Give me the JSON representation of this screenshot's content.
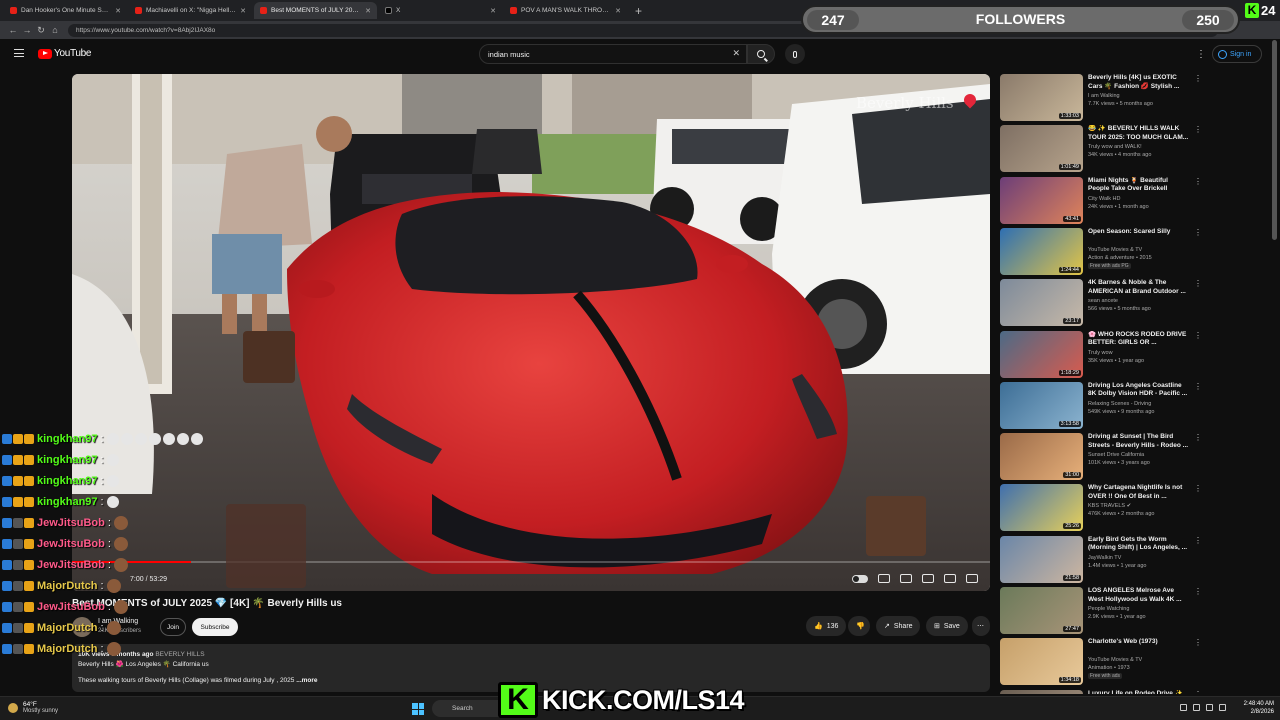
{
  "browser": {
    "tabs": [
      {
        "label": "Dan Hooker's One Minute Scrapi"
      },
      {
        "label": "Machiavelli on X: \"Nigga Hell Hit"
      },
      {
        "label": "Best MOMENTS of JULY 2025 🇺",
        "active": true
      },
      {
        "label": "X"
      },
      {
        "label": "POV A MAN'S WALK THROUG"
      }
    ],
    "url": "https://www.youtube.com/watch?v=8Abj2IJAX8o"
  },
  "youtube": {
    "logo": "YouTube",
    "search_value": "indian music",
    "sign_in": "Sign in"
  },
  "overlay": {
    "followers_current": "247",
    "followers_label": "FOLLOWERS",
    "followers_goal": "250",
    "viewer_count": "24",
    "kick_letter": "K",
    "kick_url": "KICK.COM/LS14"
  },
  "player": {
    "watermark": "Beverly Hills",
    "timecode": "7:00 / 53:29",
    "progress": 0.13
  },
  "video": {
    "title": "Best MOMENTS of JULY 2025 💎 [4K] 🌴 Beverly Hills us",
    "channel": "I am Walking",
    "subscribers": "21K subscribers",
    "join": "Join",
    "subscribe": "Subscribe",
    "likes": "136",
    "share": "Share",
    "save": "Save",
    "desc_meta": "10K views  6 months ago",
    "desc_hashtag": "BEVERLY HILLS",
    "desc_line2": "Beverly Hills 🌺 Los Angeles 🌴 California us",
    "desc_text": "These walking tours of Beverly Hills (Collage) was filmed during July , 2025 ",
    "desc_more": "...more"
  },
  "recommendations": [
    {
      "title": "Beverly Hills [4K] us EXOTIC Cars 🌴 Fashion 💋 Stylish ...",
      "channel": "I am Walking",
      "views": "7.7K views • 5 months ago",
      "duration": "1:33:03",
      "badge": "",
      "c1": "#8a7a6a",
      "c2": "#c9b79a"
    },
    {
      "title": "😂 ✨ BEVERLY HILLS WALK TOUR 2025: TOO MUCH GLAM...",
      "channel": "Truly wow and WALK!",
      "views": "34K views • 4 months ago",
      "duration": "1:01:49",
      "badge": "",
      "c1": "#7e6f63",
      "c2": "#b7a48c"
    },
    {
      "title": "Miami Nights 🍹 Beautiful People Take Over Brickell",
      "channel": "City Walk HD",
      "views": "24K views • 1 month ago",
      "duration": "43:41",
      "badge": "",
      "c1": "#6c3e78",
      "c2": "#e0845a"
    },
    {
      "title": "Open Season: Scared Silly",
      "channel": "YouTube Movies & TV",
      "views": "Action & adventure • 2015",
      "duration": "1:24:44",
      "badge": "Free with ads  PG",
      "c1": "#2e6fb3",
      "c2": "#e3c546"
    },
    {
      "title": "4K Barnes & Noble & The AMERICAN at Brand Outdoor ...",
      "channel": "sean ancete",
      "views": "566 views • 5 months ago",
      "duration": "23:17",
      "badge": "",
      "c1": "#7d8a9a",
      "c2": "#c7b9a8"
    },
    {
      "title": "🌸 WHO ROCKS RODEO DRIVE BETTER: GIRLS OR ...",
      "channel": "Truly wow",
      "views": "35K views • 1 year ago",
      "duration": "1:18:29",
      "badge": "",
      "c1": "#4c6a86",
      "c2": "#d85b4e"
    },
    {
      "title": "Driving Los Angeles Coastline 8K Dolby Vision HDR - Pacific ...",
      "channel": "Relaxing Scenes - Driving",
      "views": "549K views • 9 months ago",
      "duration": "3:13:58",
      "badge": "",
      "c1": "#3d6e96",
      "c2": "#8bb3cf"
    },
    {
      "title": "Driving at Sunset | The Bird Streets - Beverly Hills - Rodeo ...",
      "channel": "Sunset Drive California",
      "views": "101K views • 3 years ago",
      "duration": "31:00",
      "badge": "",
      "c1": "#9a6a48",
      "c2": "#e7b07a"
    },
    {
      "title": "Why Cartagena Nightlife Is not OVER !! One Of Best in ...",
      "channel": "KBS TRAVELS ✔",
      "views": "476K views • 2 months ago",
      "duration": "25:26",
      "badge": "",
      "c1": "#3f6fae",
      "c2": "#e7d05a"
    },
    {
      "title": "Early Bird Gets the Worm (Morning Shift) | Los Angeles, ...",
      "channel": "JayWalkin TV",
      "views": "1.4M views • 1 year ago",
      "duration": "21:58",
      "badge": "",
      "c1": "#6a86a8",
      "c2": "#cdb6a0"
    },
    {
      "title": "LOS ANGELES Melrose Ave West Hollywood us Walk 4K ...",
      "channel": "People Watching",
      "views": "2.9K views • 1 year ago",
      "duration": "27:47",
      "badge": "",
      "c1": "#6b7a5a",
      "c2": "#a89478"
    },
    {
      "title": "Charlotte's Web (1973)",
      "channel": "YouTube Movies & TV",
      "views": "Animation • 1973",
      "duration": "1:34:18",
      "badge": "Free with ads",
      "c1": "#c6a06a",
      "c2": "#e8c99a"
    },
    {
      "title": "Luxury Life on Rodeo Drive ✨",
      "channel": "",
      "views": "",
      "duration": "",
      "badge": "",
      "c1": "#6a5e52",
      "c2": "#a99683"
    }
  ],
  "chat": [
    {
      "user": "kingkhan97",
      "color": "#53fc18",
      "emotes": 7,
      "skull": true
    },
    {
      "user": "kingkhan97",
      "color": "#53fc18",
      "emotes": 1,
      "skull": true
    },
    {
      "user": "kingkhan97",
      "color": "#53fc18",
      "emotes": 1,
      "skull": true
    },
    {
      "user": "kingkhan97",
      "color": "#53fc18",
      "emotes": 1,
      "skull": true
    },
    {
      "user": "JewJitsuBob",
      "color": "#ff5a8a",
      "emotes": 1,
      "skull": false
    },
    {
      "user": "JewJitsuBob",
      "color": "#ff5a8a",
      "emotes": 1,
      "skull": false
    },
    {
      "user": "JewJitsuBob",
      "color": "#ff5a8a",
      "emotes": 1,
      "skull": false
    },
    {
      "user": "MajorDutch",
      "color": "#e6c84a",
      "emotes": 1,
      "skull": false
    },
    {
      "user": "JewJitsuBob",
      "color": "#ff5a8a",
      "emotes": 1,
      "skull": false
    },
    {
      "user": "MajorDutch",
      "color": "#e6c84a",
      "emotes": 1,
      "skull": false
    },
    {
      "user": "MajorDutch",
      "color": "#e6c84a",
      "emotes": 1,
      "skull": false
    }
  ],
  "taskbar": {
    "temp": "64°F",
    "condition": "Mostly sunny",
    "search": "Search",
    "time": "2:48:40 AM",
    "date": "2/8/2026"
  }
}
